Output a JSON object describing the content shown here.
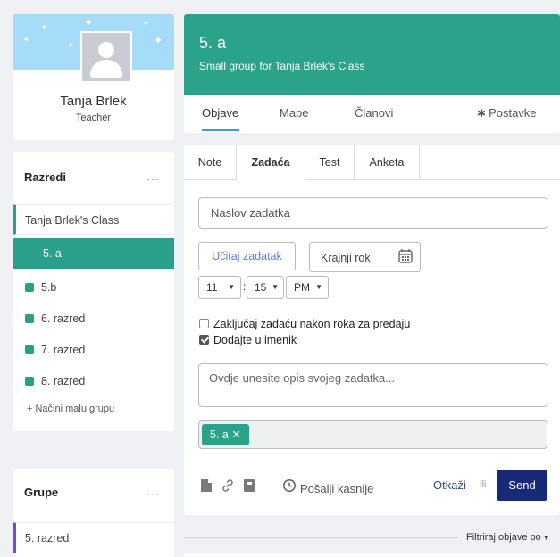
{
  "profile": {
    "name": "Tanja Brlek",
    "role": "Teacher",
    "banner_color": "#a6dcf7"
  },
  "classes": {
    "title": "Razredi",
    "more": "...",
    "main_class": "Tanja Brlek's Class",
    "active": "5. a",
    "items": [
      "5.b",
      "6. razred",
      "7. razred",
      "8. razred"
    ],
    "add_group": "+ Načini malu grupu",
    "accent": "#2a9f8a"
  },
  "groups": {
    "title": "Grupe",
    "more": "...",
    "items": [
      "5. razred"
    ],
    "accent": "#8a3fcf"
  },
  "header": {
    "title": "5. a",
    "subtitle": "Small group for Tanja Brlek's Class",
    "tabs": [
      "Objave",
      "Mape",
      "Članovi"
    ],
    "settings": "Postavke",
    "active_tab": "Objave"
  },
  "composer": {
    "tabs": [
      "Note",
      "Zadaća",
      "Test",
      "Anketa"
    ],
    "active_tab": "Zadaća",
    "title_placeholder": "Naslov zadatka",
    "upload_label": "Učitaj zadatak",
    "deadline_label": "Krajnji rok",
    "hour": "11",
    "minute": "15",
    "ampm": "PM",
    "colon": ":",
    "lock_label": "Zaključaj zadaću nakon roka za predaju",
    "lock_checked": false,
    "gradebook_label": "Dodajte u imenik",
    "gradebook_checked": true,
    "desc_placeholder": "Ovdje unesite opis svojeg zadatka...",
    "recipient": "5. a",
    "send_later": "Pošalji kasnije",
    "cancel": "Otkaži",
    "or": "ili",
    "send": "Send",
    "send_color": "#172a7a"
  },
  "filter": {
    "label": "Filtriraj objave po"
  }
}
